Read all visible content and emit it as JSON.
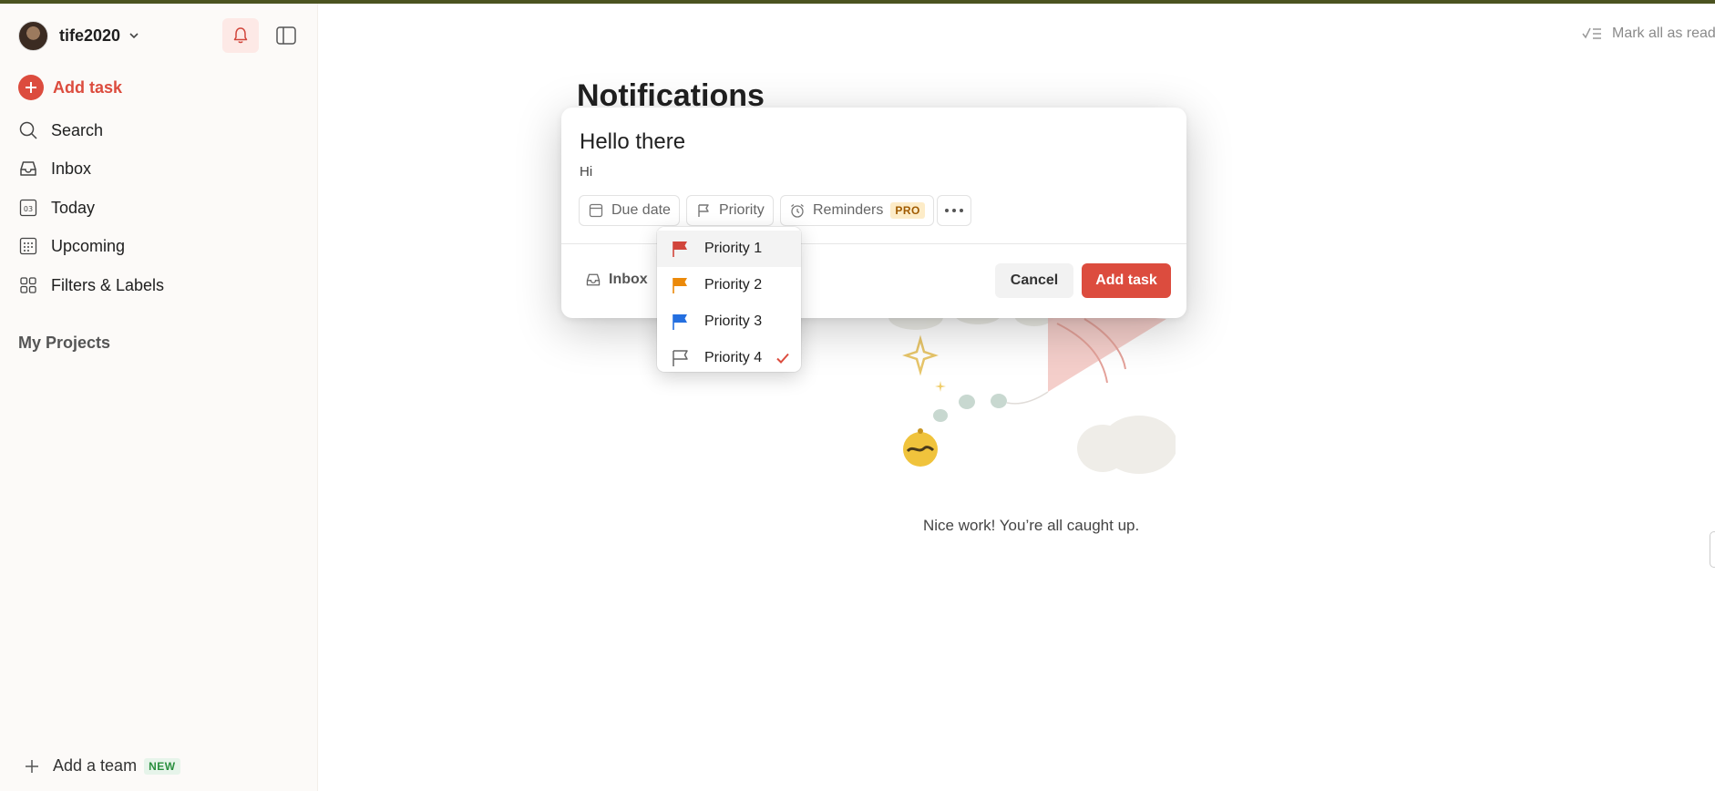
{
  "user": {
    "name": "tife2020"
  },
  "sidebar": {
    "add_task": "Add task",
    "items": [
      {
        "label": "Search",
        "icon": "search-icon"
      },
      {
        "label": "Inbox",
        "icon": "inbox-icon"
      },
      {
        "label": "Today",
        "icon": "calendar-today-icon",
        "day": "03"
      },
      {
        "label": "Upcoming",
        "icon": "calendar-grid-icon"
      },
      {
        "label": "Filters & Labels",
        "icon": "grid-icon"
      }
    ],
    "my_projects": "My Projects",
    "add_team": "Add a team",
    "new_badge": "NEW"
  },
  "main": {
    "title": "Notifications",
    "mark_all": "Mark all as read",
    "empty_text": "Nice work! You’re all caught up."
  },
  "task_modal": {
    "title": "Hello there",
    "description": "Hi",
    "chips": {
      "due": "Due date",
      "priority": "Priority",
      "reminders": "Reminders",
      "pro": "PRO"
    },
    "project": "Inbox",
    "cancel": "Cancel",
    "submit": "Add task"
  },
  "priority_menu": {
    "items": [
      {
        "label": "Priority 1",
        "color": "#d1453b",
        "filled": true
      },
      {
        "label": "Priority 2",
        "color": "#eb8909",
        "filled": true
      },
      {
        "label": "Priority 3",
        "color": "#246fe0",
        "filled": true
      },
      {
        "label": "Priority 4",
        "color": "#666666",
        "filled": false,
        "selected": true
      }
    ],
    "check_color": "#dc4c3e"
  },
  "colors": {
    "accent": "#dc4c3e",
    "top_strip": "#4b5320"
  }
}
